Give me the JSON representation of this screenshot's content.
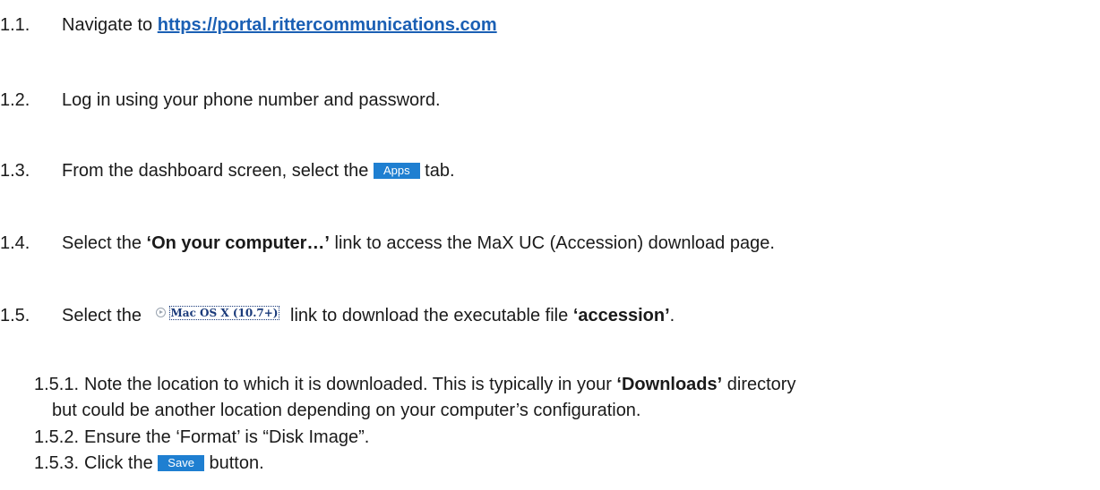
{
  "steps": [
    {
      "num": "1.1.",
      "pre": "Navigate to ",
      "link": "https://portal.rittercommunications.com"
    },
    {
      "num": "1.2.",
      "text": "Log in using your phone number and password."
    },
    {
      "num": "1.3.",
      "pre": "From the dashboard screen, select the ",
      "button": "Apps",
      "post": " tab."
    },
    {
      "num": "1.4.",
      "pre": "Select the ",
      "bold": "‘On your computer…’",
      "post": " link to access the MaX UC (Accession) download page."
    },
    {
      "num": "1.5.",
      "pre": "Select the ",
      "link_label": "Mac OS X (10.7+)",
      "mid": " link to download the executable file ",
      "bold": "‘accession’",
      "post": "."
    }
  ],
  "substeps": [
    {
      "num": "1.5.1.",
      "pre": "Note the location to which it is downloaded. This is typically in your ",
      "bold": "‘Downloads’",
      "post": " directory",
      "continuation": "but could be another location depending on your computer’s configuration."
    },
    {
      "num": "1.5.2.",
      "text": "Ensure the ‘Format’ is “Disk Image”."
    },
    {
      "num": "1.5.3.",
      "pre": "Click the ",
      "button": "Save",
      "post": " button."
    }
  ],
  "colors": {
    "link": "#1a5fb4",
    "button": "#1f7fd1"
  },
  "icons": {
    "mac_link": "circle-arrow-icon"
  }
}
